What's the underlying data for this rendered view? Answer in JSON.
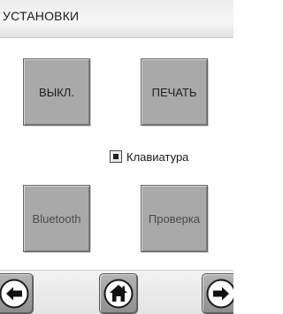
{
  "header": {
    "title": "УСТАНОВКИ"
  },
  "buttons": {
    "off_label": "ВЫКЛ.",
    "print_label": "ПЕЧАТЬ",
    "bluetooth_label": "Bluetooth",
    "check_label": "Проверка"
  },
  "keyboard_option": {
    "label": "Клавиатура",
    "checked": true
  },
  "navigation": {
    "back_icon": "arrow-left-icon",
    "home_icon": "home-icon",
    "forward_icon": "arrow-right-icon"
  },
  "colors": {
    "tile_fill": "#a9a9a9",
    "tile_border": "#666666",
    "title_bar": "#efefef"
  }
}
